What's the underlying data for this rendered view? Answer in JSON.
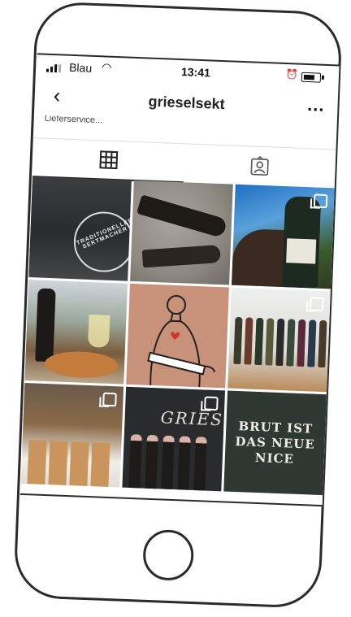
{
  "status_bar": {
    "carrier": "Blau",
    "time": "13:41"
  },
  "header": {
    "username": "grieselsekt",
    "bio_snippet": "Lieferservice...",
    "more_label": "..."
  },
  "tabs": [
    {
      "name": "posts-grid",
      "icon": "grid-icon"
    },
    {
      "name": "tagged",
      "icon": "tagged-person-icon"
    }
  ],
  "posts": [
    {
      "badge_text": "TRADITIONELLER SEKTMACHER"
    },
    {},
    {},
    {},
    {},
    {},
    {},
    {
      "brand": "GRIES"
    },
    {
      "slogan": "BRUT IST DAS NEUE NICE"
    }
  ],
  "colors": {
    "ink": "#2b2b2b",
    "accent_tile": "#c8917a",
    "slogan_tile": "#2f3833"
  }
}
